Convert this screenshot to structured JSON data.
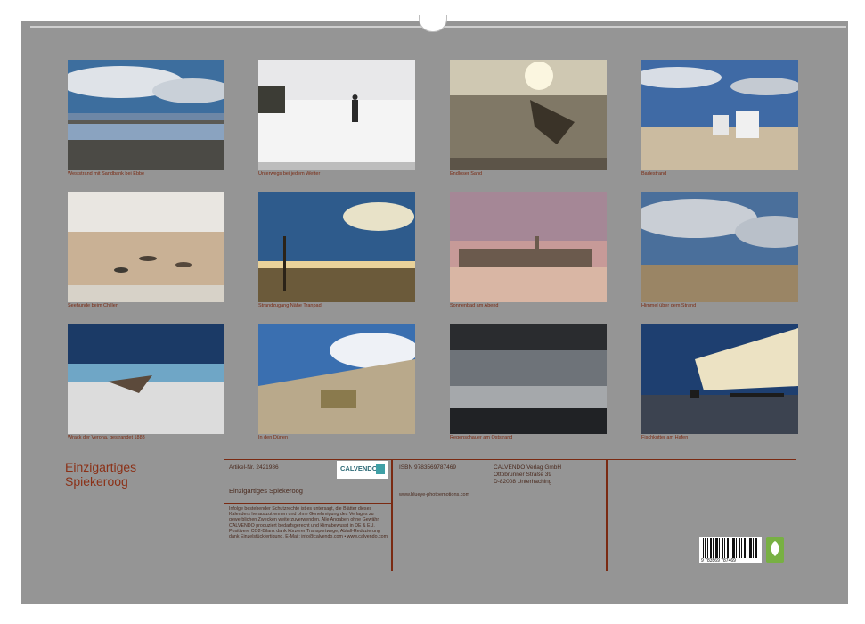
{
  "photos": [
    {
      "caption": "Weststrand mit Sandbank bei Ebbe"
    },
    {
      "caption": "Unterwegs bei jedem Wetter"
    },
    {
      "caption": "Endloser Sand"
    },
    {
      "caption": "Badestrand"
    },
    {
      "caption": "Seehunde beim Chillen"
    },
    {
      "caption": "Strandzugang Nähe Tranpad"
    },
    {
      "caption": "Sonnenbad am Abend"
    },
    {
      "caption": "Himmel über dem Strand"
    },
    {
      "caption": "Wrack der Verona, gestrandet 1883"
    },
    {
      "caption": "In den Dünen"
    },
    {
      "caption": "Regenschauer am Oststrand"
    },
    {
      "caption": "Fischkutter am Hafen"
    }
  ],
  "title": {
    "line1": "Einzigartiges",
    "line2": "Spiekeroog"
  },
  "info": {
    "article": "Artikel-Nr. 2421986",
    "book_title": "Einzigartiges Spiekeroog",
    "isbn": "ISBN 9783569787469",
    "publisher_name": "CALVENDO Verlag GmbH",
    "publisher_street": "Ottobrunner Straße 39",
    "publisher_city": "D-82008 Unterhaching",
    "website": "www.blueye-photoemotions.com",
    "logo_text": "CALVENDO",
    "barcode_number": "9 783569 787469",
    "legal": "Infolge bestehender Schutzrechte ist es untersagt, die Blätter dieses Kalenders herauszutrennen und ohne Genehmigung des Verlages zu gewerblichen Zwecken weiterzuverwenden. Alle Angaben ohne Gewähr. CALVENDO produziert bedarfsgerecht und klimabewusst in DE & EU. Positivere CO2-Bilanz dank kürzerer Transportwege, Abfall-Reduzierung dank Einzelstückfertigung. E-Mail: info@calvendo.com • www.calvendo.com"
  },
  "colors": {
    "background": "#959595",
    "accent": "#8b3117"
  }
}
